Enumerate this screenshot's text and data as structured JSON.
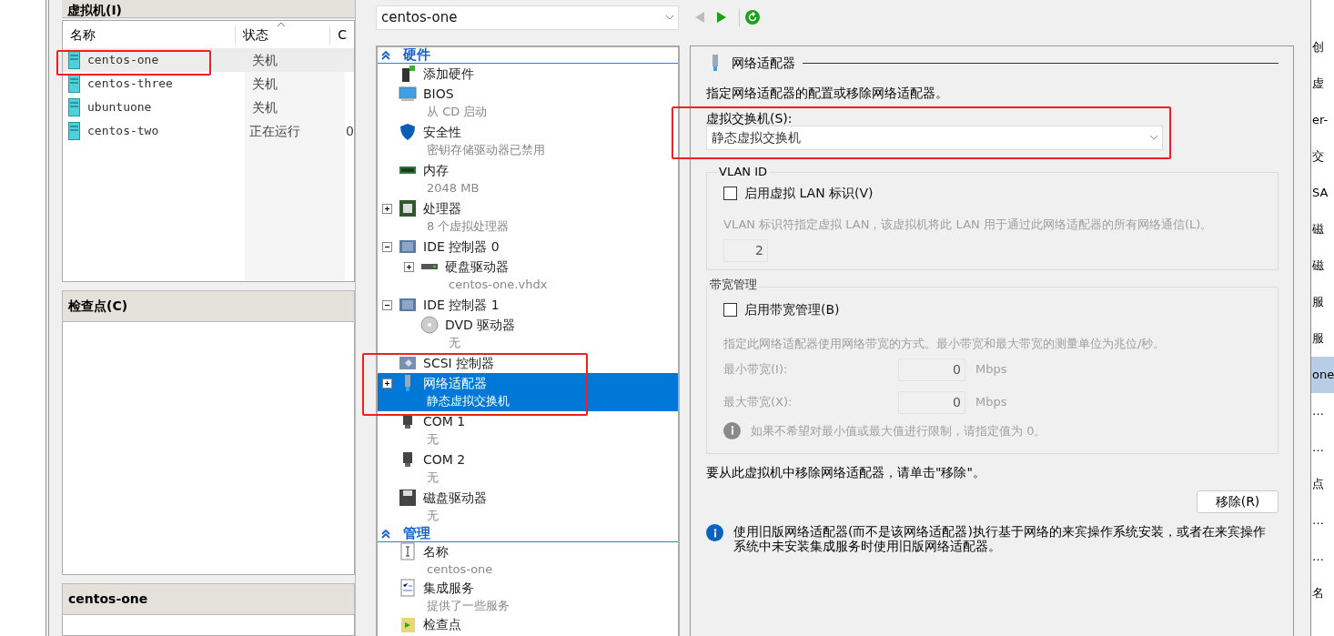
{
  "vm_panel": {
    "title": "虚拟机(I)",
    "columns": [
      "名称",
      "状态",
      "C"
    ],
    "rows": [
      {
        "name": "centos-one",
        "state": "关机",
        "selected": true
      },
      {
        "name": "centos-three",
        "state": "关机",
        "selected": false
      },
      {
        "name": "ubuntuone",
        "state": "关机",
        "selected": false
      },
      {
        "name": "centos-two",
        "state": "正在运行",
        "column_3": "0",
        "selected": false
      }
    ]
  },
  "checkpoint_panel": {
    "title": "检查点(C)"
  },
  "details_panel": {
    "title": "centos-one"
  },
  "vm_select": {
    "value": "centos-one"
  },
  "tree": [
    {
      "title": "硬件",
      "items": [
        {
          "kind": "addhardware",
          "label": "添加硬件",
          "selected": false
        },
        {
          "kind": "bios",
          "label": "BIOS",
          "sub": "从 CD 启动",
          "selected": false
        },
        {
          "kind": "security",
          "label": "安全性",
          "sub": "密钥存储驱动器已禁用",
          "selected": false
        },
        {
          "kind": "memory",
          "label": "内存",
          "sub": "2048 MB",
          "selected": false
        },
        {
          "kind": "cpu",
          "label": "处理器",
          "sub": "8 个虚拟处理器",
          "expanded": false,
          "selected": false
        },
        {
          "kind": "ide",
          "label": "IDE 控制器 0",
          "expanded": true,
          "selected": false,
          "children": [
            {
              "kind": "disk",
              "label": "硬盘驱动器",
              "sub": "centos-one.vhdx",
              "expanded": false,
              "selected": false
            }
          ]
        },
        {
          "kind": "ide",
          "label": "IDE 控制器 1",
          "expanded": true,
          "selected": false,
          "children": [
            {
              "kind": "dvd",
              "label": "DVD 驱动器",
              "sub": "无",
              "selected": false
            }
          ]
        },
        {
          "kind": "scsi",
          "label": "SCSI 控制器",
          "selected": false
        },
        {
          "kind": "nic",
          "label": "网络适配器",
          "sub": "静态虚拟交换机",
          "expanded": false,
          "selected": true
        },
        {
          "kind": "com",
          "label": "COM 1",
          "sub": "无",
          "selected": false
        },
        {
          "kind": "com",
          "label": "COM 2",
          "sub": "无",
          "selected": false
        },
        {
          "kind": "floppy",
          "label": "磁盘驱动器",
          "sub": "无",
          "selected": false
        }
      ]
    },
    {
      "title": "管理",
      "items": [
        {
          "kind": "name",
          "label": "名称",
          "sub": "centos-one",
          "selected": false
        },
        {
          "kind": "services",
          "label": "集成服务",
          "sub": "提供了一些服务",
          "selected": false
        },
        {
          "kind": "checkpoint",
          "label": "检查点",
          "selected": false
        }
      ]
    }
  ],
  "settings": {
    "title": "网络适配器",
    "description": "指定网络适配器的配置或移除网络适配器。",
    "switch_label": "虚拟交换机(S):",
    "switch_value": "静态虚拟交换机",
    "vlan": {
      "legend": "VLAN ID",
      "checkbox": {
        "label": "启用虚拟 LAN 标识(V)",
        "checked": false
      },
      "hint": "VLAN 标识符指定虚拟 LAN，该虚拟机将此 LAN 用于通过此网络适配器的所有网络通信(L)。",
      "value": "2"
    },
    "bandwidth": {
      "legend": "带宽管理",
      "checkbox": {
        "label": "启用带宽管理(B)",
        "checked": false
      },
      "hint": "指定此网络适配器使用网络带宽的方式。最小带宽和最大带宽的测量单位为兆位/秒。",
      "fields": [
        {
          "label": "最小带宽(I):",
          "value": "0",
          "unit": "Mbps"
        },
        {
          "label": "最大带宽(X):",
          "value": "0",
          "unit": "Mbps"
        }
      ],
      "note": "如果不希望对最小值或最大值进行限制，请指定值为 0。"
    },
    "remove_text": "要从此虚拟机中移除网络适配器，请单击\"移除\"。",
    "remove_button": "移除(R)",
    "info": "使用旧版网络适配器(而不是该网络适配器)执行基于网络的来宾操作系统安装，或者在来宾操作系统中未安装集成服务时使用旧版网络适配器。"
  },
  "actions_strip": [
    {
      "text": "创",
      "selected": false
    },
    {
      "text": "虚",
      "selected": false
    },
    {
      "text": "er-",
      "selected": false
    },
    {
      "text": "交",
      "selected": false
    },
    {
      "text": "SA",
      "selected": false
    },
    {
      "text": "磁",
      "selected": false
    },
    {
      "text": "磁",
      "selected": false
    },
    {
      "text": "服",
      "selected": false
    },
    {
      "text": "服",
      "selected": false
    },
    {
      "text": "one",
      "selected": true
    },
    {
      "text": "…",
      "selected": false
    },
    {
      "text": "…",
      "selected": false
    },
    {
      "text": "点",
      "selected": false
    },
    {
      "text": "…",
      "selected": false
    },
    {
      "text": "…",
      "selected": false
    },
    {
      "text": "名",
      "selected": false
    }
  ]
}
